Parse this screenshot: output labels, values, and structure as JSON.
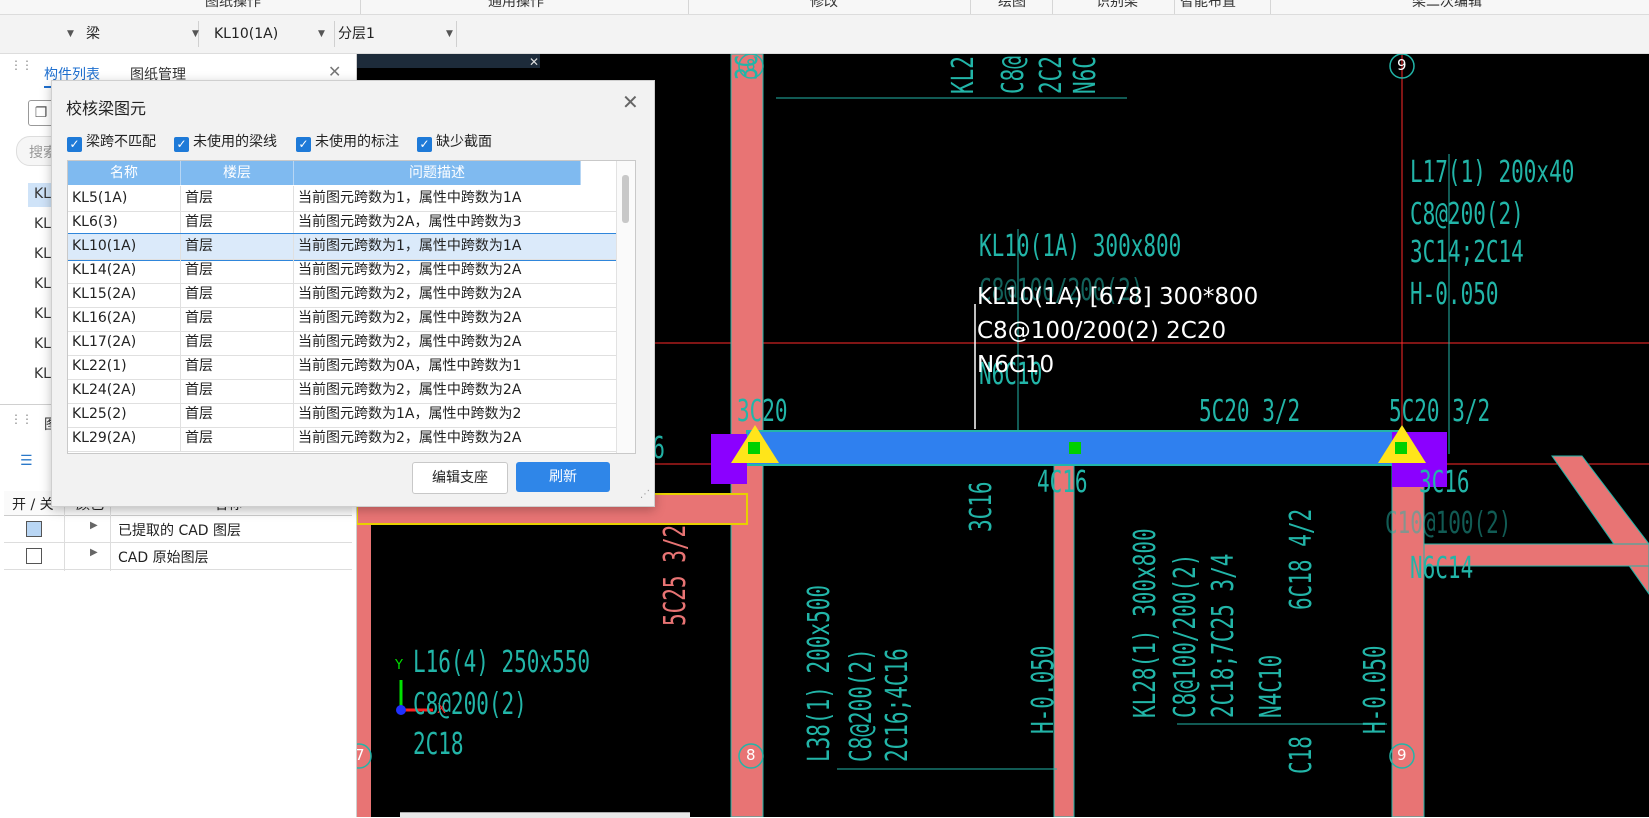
{
  "ribbon": {
    "items": [
      "图纸操作",
      "通用操作",
      "修改",
      "绘图",
      "识别梁",
      "智能布置",
      "梁二次编辑"
    ]
  },
  "selectors": [
    {
      "value": "梁"
    },
    {
      "value": "KL10(1A)"
    },
    {
      "value": "分层1"
    }
  ],
  "left_panel": {
    "tabs": [
      "构件列表",
      "图纸管理"
    ],
    "search_placeholder": "搜索",
    "items": [
      "KL",
      "KL",
      "KL",
      "KL",
      "KL",
      "KL",
      "KL"
    ],
    "layers_section_label": "图层",
    "layers_header": {
      "toggle": "开 / 关",
      "color": "颜色",
      "name": "名称"
    },
    "layers": [
      {
        "name": "已提取的 CAD 图层",
        "checked": true
      },
      {
        "name": "CAD 原始图层",
        "checked": false
      }
    ]
  },
  "dialog": {
    "title": "校核梁图元",
    "filters": [
      {
        "label": "梁跨不匹配",
        "checked": true
      },
      {
        "label": "未使用的梁线",
        "checked": true
      },
      {
        "label": "未使用的标注",
        "checked": true
      },
      {
        "label": "缺少截面",
        "checked": true
      }
    ],
    "columns": [
      "名称",
      "楼层",
      "问题描述"
    ],
    "rows": [
      {
        "name": "KL5(1A)",
        "floor": "首层",
        "desc": "当前图元跨数为1，属性中跨数为1A"
      },
      {
        "name": "KL6(3)",
        "floor": "首层",
        "desc": "当前图元跨数为2A，属性中跨数为3"
      },
      {
        "name": "KL10(1A)",
        "floor": "首层",
        "desc": "当前图元跨数为1，属性中跨数为1A"
      },
      {
        "name": "KL14(2A)",
        "floor": "首层",
        "desc": "当前图元跨数为2，属性中跨数为2A"
      },
      {
        "name": "KL15(2A)",
        "floor": "首层",
        "desc": "当前图元跨数为2，属性中跨数为2A"
      },
      {
        "name": "KL16(2A)",
        "floor": "首层",
        "desc": "当前图元跨数为2，属性中跨数为2A"
      },
      {
        "name": "KL17(2A)",
        "floor": "首层",
        "desc": "当前图元跨数为2，属性中跨数为2A"
      },
      {
        "name": "KL22(1)",
        "floor": "首层",
        "desc": "当前图元跨数为0A，属性中跨数为1"
      },
      {
        "name": "KL24(2A)",
        "floor": "首层",
        "desc": "当前图元跨数为2，属性中跨数为2A"
      },
      {
        "name": "KL25(2)",
        "floor": "首层",
        "desc": "当前图元跨数为1A，属性中跨数为2"
      },
      {
        "name": "KL29(2A)",
        "floor": "首层",
        "desc": "当前图元跨数为2，属性中跨数为2A"
      }
    ],
    "selected_row": "KL10(1A)",
    "edit_support_button": "编辑支座",
    "refresh_button": "刷新"
  },
  "cad": {
    "axis_labels": {
      "a8": "8",
      "a9": "9",
      "a7": "7"
    },
    "beam_label": [
      "KL10(1A) [678] 300*800",
      "C8@100/200(2) 2C20",
      "N6C10"
    ],
    "texts": {
      "kl10": "KL10(1A) 300x800",
      "kl10b": "C8@100/200(2)",
      "kl10c": "N6C10",
      "t3c20": "3C20",
      "t5c20a": "5C20 3/2",
      "t5c20b": "5C20 3/2",
      "l17a": "L17(1) 200x40",
      "l17b": "C8@200(2)",
      "l17c": "3C14;2C14",
      "l17d": "H-0.050",
      "t4c16": "4C16",
      "t3c16": "3C16",
      "c10": "C10@100(2)",
      "n6c14": "N6C14",
      "c16": "C16",
      "t50": "50",
      "l16a": "L16(4) 250x550",
      "l16b": "C8@200(2)",
      "l16c": "2C18",
      "v5c25": "5C25 3/2",
      "v3c16": "3C16",
      "vl38a": "L38(1) 200x500",
      "vl38b": "C8@200(2)",
      "vl38c": "2C16;4C16",
      "vh1": "H-0.050",
      "vkl28a": "KL28(1) 300x800",
      "vkl28b": "C8@100/200(2)",
      "vkl28c": "2C18;7C25 3/4",
      "vkl28d": "N4C10",
      "v6c18": "6C18 4/2",
      "vh2": "H-0.050",
      "vc18": "C18",
      "top1": "KL2",
      "top2": "C8@",
      "top3": "2C2",
      "top4": "N6C",
      "top3c": "3C",
      "axis_x": "X",
      "axis_y": "Y"
    },
    "colors": {
      "column": "#e87474",
      "beam": "#2f80ef",
      "support": "#ffe51a",
      "grid": "#ff2a2a",
      "text": "#22b5a8",
      "purple": "#8b00ff"
    }
  }
}
